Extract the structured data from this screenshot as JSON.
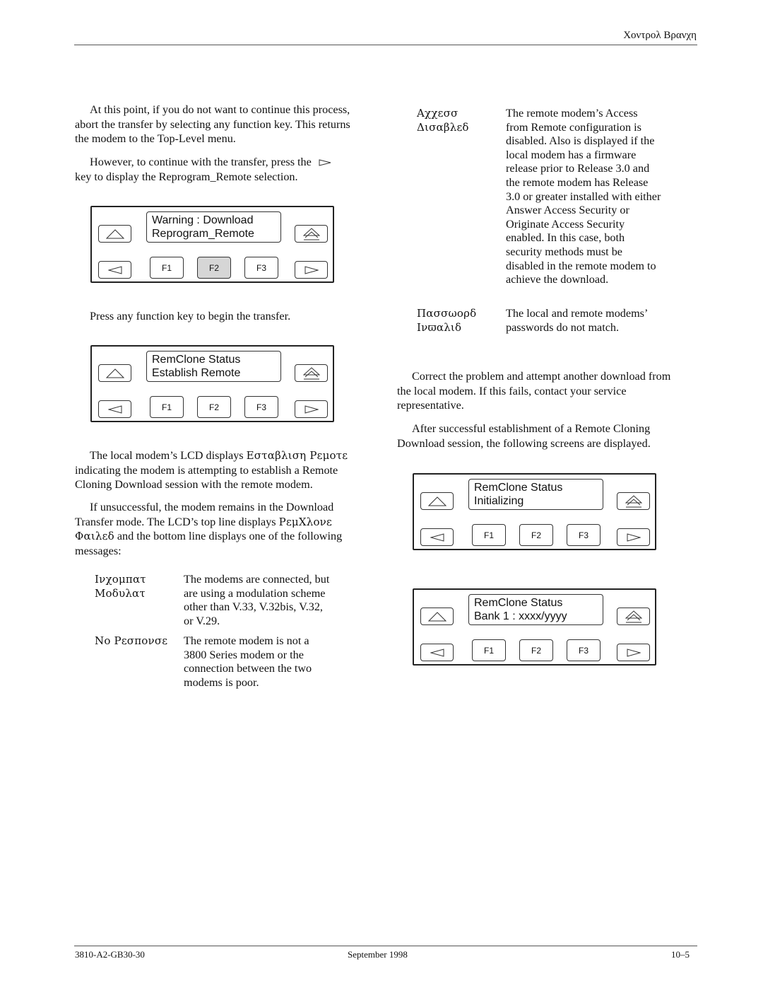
{
  "header": {
    "section_title": "Χοντρολ Βρανχη"
  },
  "left_column": {
    "para1": "At this point, if you do not want to continue this process, abort the transfer by selecting any function key. This returns the modem to the Top-Level menu.",
    "para2_before": "However, to continue with the transfer, press the",
    "para2_icon": "right-arrow-key-icon",
    "para2_after": "key to display the Reprogram_Remote selection.",
    "para3": "Press any function key to begin the transfer.",
    "para4_before": "The local modem’s LCD displays ",
    "para4_symbol": "Εσταβλιση Ρεμοτε",
    "para4_after": " indicating the modem is attempting to establish a Remote Cloning Download session with the remote modem.",
    "para5_before": "If unsuccessful, the modem remains in the Download Transfer mode. The LCD’s top line displays ",
    "para5_symbol1": "ΡεμΧλονε Φαιλεδ",
    "para5_after": "and the bottom line displays one of the following messages:",
    "messages": [
      {
        "term_line1": "Ινχομπατ",
        "term_line2": "Μοδυλατ",
        "description": "The modems are connected, but are using a modulation scheme other than V.33, V.32bis, V.32, or V.29."
      },
      {
        "term_line1": "Νο Ρεσπονσε",
        "term_line2": "",
        "description": "The remote modem is not a 3800 Series modem or the connection between the two modems is poor."
      }
    ]
  },
  "right_column": {
    "messages": [
      {
        "term_line1": "Αχχεσσ",
        "term_line2": "Δισαβλεδ",
        "description": "The remote modem’s Access from Remote configuration is disabled. Also is displayed if the local modem has a firmware release prior to Release 3.0 and the remote modem has Release 3.0 or greater installed with either Answer Access Security or Originate Access Security enabled. In this case, both security methods must be disabled in the remote modem to achieve the download."
      },
      {
        "term_line1": "Πασσωορδ",
        "term_line2": "Ινϖαλιδ",
        "description": "The local and remote modems’ passwords do not match."
      }
    ],
    "para1": "Correct the problem and attempt another download from the local modem. If this fails, contact your service representative.",
    "para2": "After successful establishment of a Remote Cloning Download session, the following screens are displayed."
  },
  "panels": [
    {
      "lcd_line1": "Warning : Download",
      "lcd_line2": "Reprogram_Remote",
      "f1": "F1",
      "f2": "F2",
      "f3": "F3",
      "pressed_key": "F2"
    },
    {
      "lcd_line1": "RemClone Status",
      "lcd_line2": "Establish Remote",
      "f1": "F1",
      "f2": "F2",
      "f3": "F3",
      "pressed_key": ""
    },
    {
      "lcd_line1": "RemClone Status",
      "lcd_line2": "Initializing",
      "f1": "F1",
      "f2": "F2",
      "f3": "F3",
      "pressed_key": ""
    },
    {
      "lcd_line1": "RemClone Status",
      "lcd_line2": "Bank 1 : xxxx/yyyy",
      "f1": "F1",
      "f2": "F2",
      "f3": "F3",
      "pressed_key": ""
    }
  ],
  "panel_icons": {
    "up": "up-arrow-icon",
    "top": "top-level-double-arrow-icon",
    "left": "left-arrow-icon",
    "right": "right-arrow-icon"
  },
  "footer": {
    "doc_number": "3810-A2-GB30-30",
    "date": "September 1998",
    "page": "10–5"
  }
}
